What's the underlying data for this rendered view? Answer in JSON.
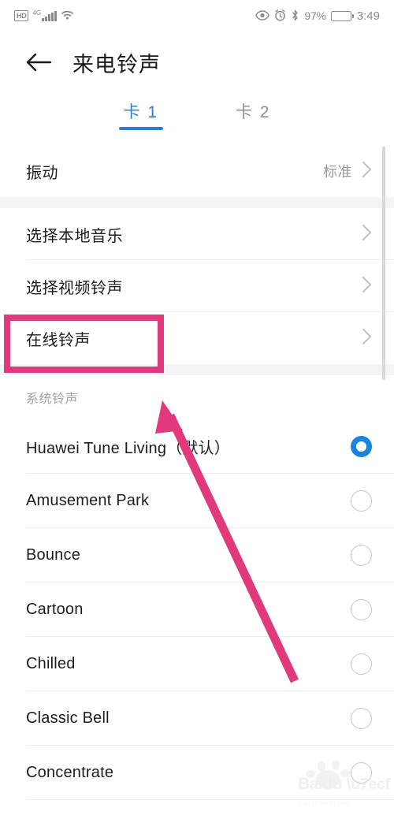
{
  "statusbar": {
    "hd_badge": "HD",
    "network_label": "4G",
    "battery_percent": "97%",
    "time": "3:49",
    "icons": [
      "hd-badge",
      "signal-bars-icon",
      "wifi-icon",
      "eye-icon",
      "alarm-clock-icon",
      "bluetooth-icon",
      "battery-icon"
    ],
    "eye_glyph": "◉",
    "alarm_glyph": "⏱",
    "bluetooth_glyph": "✱",
    "wifi_glyph": "◔"
  },
  "header": {
    "back_icon": "back-arrow-icon",
    "title": "来电铃声"
  },
  "tabs": [
    {
      "label": "卡 1",
      "active": true
    },
    {
      "label": "卡 2",
      "active": false
    }
  ],
  "vibration_row": {
    "label": "振动",
    "value": "标准",
    "chevron": "›"
  },
  "option_rows": [
    {
      "label": "选择本地音乐",
      "chevron": "›"
    },
    {
      "label": "选择视频铃声",
      "chevron": "›"
    },
    {
      "label": "在线铃声",
      "chevron": "›"
    }
  ],
  "system_section": {
    "header": "系统铃声",
    "ringtones": [
      {
        "name": "Huawei Tune Living（默认）",
        "selected": true
      },
      {
        "name": "Amusement Park",
        "selected": false
      },
      {
        "name": "Bounce",
        "selected": false
      },
      {
        "name": "Cartoon",
        "selected": false
      },
      {
        "name": "Chilled",
        "selected": false
      },
      {
        "name": "Classic Bell",
        "selected": false
      },
      {
        "name": "Concentrate",
        "selected": false
      }
    ]
  },
  "annotations": {
    "highlight_box_target": "在线铃声",
    "arrow_color": "#e13a7c",
    "box_color": "#e13a7c"
  },
  "watermark": {
    "text": "Baidu经验",
    "sub": "jingyan.baidu.com"
  },
  "colors": {
    "accent_blue": "#1784e0",
    "tab_blue": "#2a7fd4",
    "annotation_pink": "#e13a7c",
    "page_bg": "#ffffff",
    "gap_bg": "#f4f4f6"
  }
}
